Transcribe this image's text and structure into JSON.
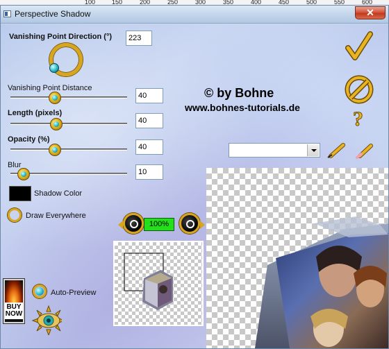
{
  "ruler": {
    "ticks": [
      "100",
      "150",
      "200",
      "250",
      "300",
      "350",
      "400",
      "450",
      "500",
      "550",
      "600"
    ]
  },
  "window": {
    "title": "Perspective Shadow",
    "close_label": "✕"
  },
  "controls": {
    "direction": {
      "label": "Vanishing Point Direction (°)",
      "value": "223"
    },
    "distance": {
      "label": "Vanishing Point Distance",
      "value": "40",
      "level": 40
    },
    "length": {
      "label": "Length (pixels)",
      "value": "40",
      "level": 40
    },
    "opacity": {
      "label": "Opacity (%)",
      "value": "40",
      "level": 40
    },
    "blur": {
      "label": "Blur",
      "value": "10",
      "level": 10
    },
    "shadow_color": {
      "label": "Shadow Color",
      "color": "#000000"
    },
    "draw_everywhere": {
      "label": "Draw Everywhere",
      "checked": false
    },
    "auto_preview": {
      "label": "Auto-Preview",
      "checked": true
    }
  },
  "zoom": {
    "label": "100%"
  },
  "brand": {
    "line1": "© by Bohne",
    "line2": "www.bohnes-tutorials.de"
  },
  "presets": {
    "selected": ""
  },
  "buy_now": {
    "label": "BUY NOW"
  },
  "colors": {
    "accent_gold": "#d7a51e",
    "zoom_green": "#23e01a",
    "check_mark": "#e0a91a"
  }
}
